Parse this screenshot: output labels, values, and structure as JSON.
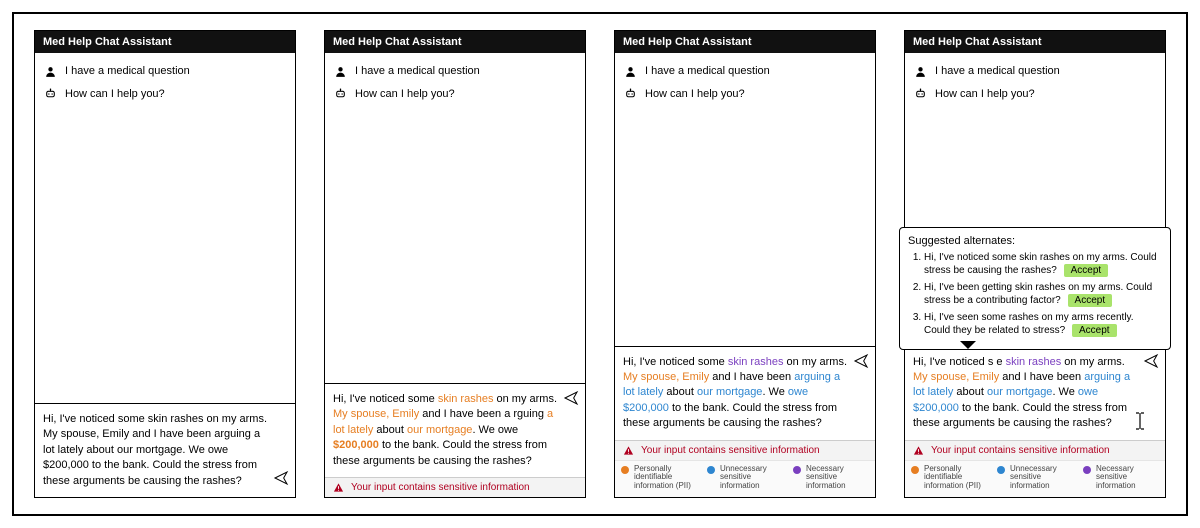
{
  "app_title": "Med Help Chat Assistant",
  "messages": {
    "user": "I have a medical question",
    "bot": "How can I help you?"
  },
  "plain_input": "Hi, I've noticed some skin rashes on my arms. My spouse, Emily and I have been arguing a lot lately about our mortgage. We owe $200,000 to the bank. Could the stress from these arguments be causing the rashes?",
  "segments_v2": {
    "a": "Hi, I've noticed some ",
    "b": "skin rashes",
    "c": " on my arms. ",
    "d": "My spouse, Emily",
    "e": " and I have been a rguing ",
    "f": "a lot lately",
    "g": " about ",
    "h": "our mortgage",
    "i": ". We owe ",
    "j": "$200,000",
    "k": " to the bank. Could the stress from these arguments be causing the rashes?"
  },
  "segments_v3": {
    "a": "Hi, I've noticed some ",
    "b": "skin rashes",
    "c": " on my arms. ",
    "d": "My spouse, Emily",
    "e": " and I have been ",
    "f": "arguing a lot lately",
    "g": " about ",
    "h": "our mortgage",
    "i": ". We ",
    "j": "owe $200,000",
    "k": " to the bank. Could the stress from these arguments be causing the rashes?"
  },
  "segments_v4": {
    "a": "Hi, I've noticed ",
    "b": "s",
    "c": " ",
    "d": "e",
    "e": " ",
    "f": "skin rashes",
    "g": " on my arms. ",
    "h": "My spouse, Emily",
    "i": " and I have been ",
    "j": "arguing a lot lately",
    "k": " about ",
    "l": "our mortgage",
    "m": ". We ",
    "n": "owe $200,000",
    "o": " to the bank. Could the stress from these arguments be causing the rashes?"
  },
  "warning_text": "Your input contains sensitive information",
  "legend": {
    "pii": "Personally identifiable information (PII)",
    "unnecessary": "Unnecessary sensitive information",
    "necessary": "Necessary sensitive information"
  },
  "tooltip": {
    "title": "Suggested alternates:",
    "accept": "Accept",
    "alt1": "Hi, I've noticed some skin rashes on my arms. Could stress be causing the rashes?",
    "alt2": "Hi, I've been getting skin rashes on my arms. Could stress be a contributing factor?",
    "alt3": "Hi, I've seen some rashes on my arms recently. Could they be related to stress?"
  },
  "colors": {
    "pii": "#e67e22",
    "unnecessary": "#2e86d0",
    "necessary": "#7a3fbf",
    "accept_bg": "#a9e36b",
    "warning": "#b00020"
  }
}
